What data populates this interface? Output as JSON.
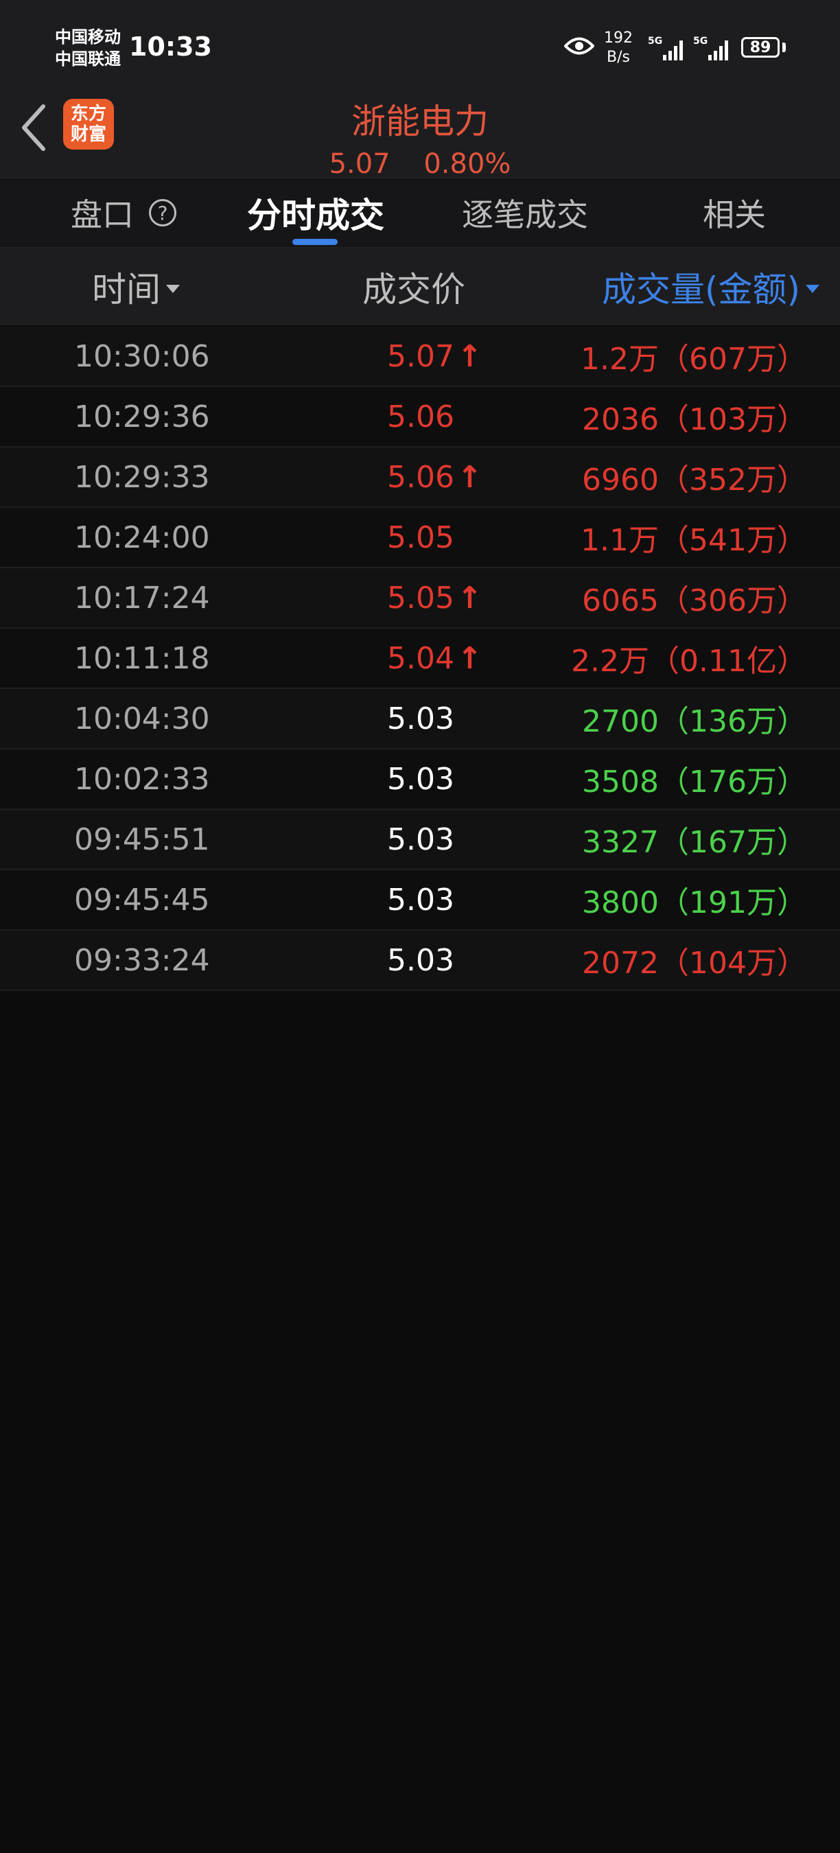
{
  "status_bar": {
    "carrier1": "中国移动",
    "carrier2": "中国联通",
    "time": "10:33",
    "net_speed_value": "192",
    "net_speed_unit": "B/s",
    "sig1_label": "5G",
    "sig2_label": "5G",
    "battery": "89"
  },
  "header": {
    "logo_line1": "东方",
    "logo_line2": "财富",
    "stock_name": "浙能电力",
    "price": "5.07",
    "change_pct": "0.80%"
  },
  "tabs": [
    {
      "label": "盘口"
    },
    {
      "label": "分时成交"
    },
    {
      "label": "逐笔成交"
    },
    {
      "label": "相关"
    }
  ],
  "help_icon": "?",
  "columns": {
    "time": "时间",
    "price": "成交价",
    "volume": "成交量(金额)"
  },
  "trades": [
    {
      "time": "10:30:06",
      "price": "5.07",
      "up": "↑",
      "volume": "1.2万（607万）",
      "price_color": "red",
      "vol_color": "red"
    },
    {
      "time": "10:29:36",
      "price": "5.06",
      "up": "",
      "volume": "2036（103万）",
      "price_color": "red",
      "vol_color": "red"
    },
    {
      "time": "10:29:33",
      "price": "5.06",
      "up": "↑",
      "volume": "6960（352万）",
      "price_color": "red",
      "vol_color": "red"
    },
    {
      "time": "10:24:00",
      "price": "5.05",
      "up": "",
      "volume": "1.1万（541万）",
      "price_color": "red",
      "vol_color": "red"
    },
    {
      "time": "10:17:24",
      "price": "5.05",
      "up": "↑",
      "volume": "6065（306万）",
      "price_color": "red",
      "vol_color": "red"
    },
    {
      "time": "10:11:18",
      "price": "5.04",
      "up": "↑",
      "volume": "2.2万（0.11亿）",
      "price_color": "red",
      "vol_color": "red"
    },
    {
      "time": "10:04:30",
      "price": "5.03",
      "up": "",
      "volume": "2700（136万）",
      "price_color": "white",
      "vol_color": "green"
    },
    {
      "time": "10:02:33",
      "price": "5.03",
      "up": "",
      "volume": "3508（176万）",
      "price_color": "white",
      "vol_color": "green"
    },
    {
      "time": "09:45:51",
      "price": "5.03",
      "up": "",
      "volume": "3327（167万）",
      "price_color": "white",
      "vol_color": "green"
    },
    {
      "time": "09:45:45",
      "price": "5.03",
      "up": "",
      "volume": "3800（191万）",
      "price_color": "white",
      "vol_color": "green"
    },
    {
      "time": "09:33:24",
      "price": "5.03",
      "up": "",
      "volume": "2072（104万）",
      "price_color": "white",
      "vol_color": "red"
    }
  ],
  "colors": {
    "red": "#e2382f",
    "green": "#4bd24b",
    "accent_blue": "#3c82e8",
    "logo_orange": "#ea5b2a"
  }
}
